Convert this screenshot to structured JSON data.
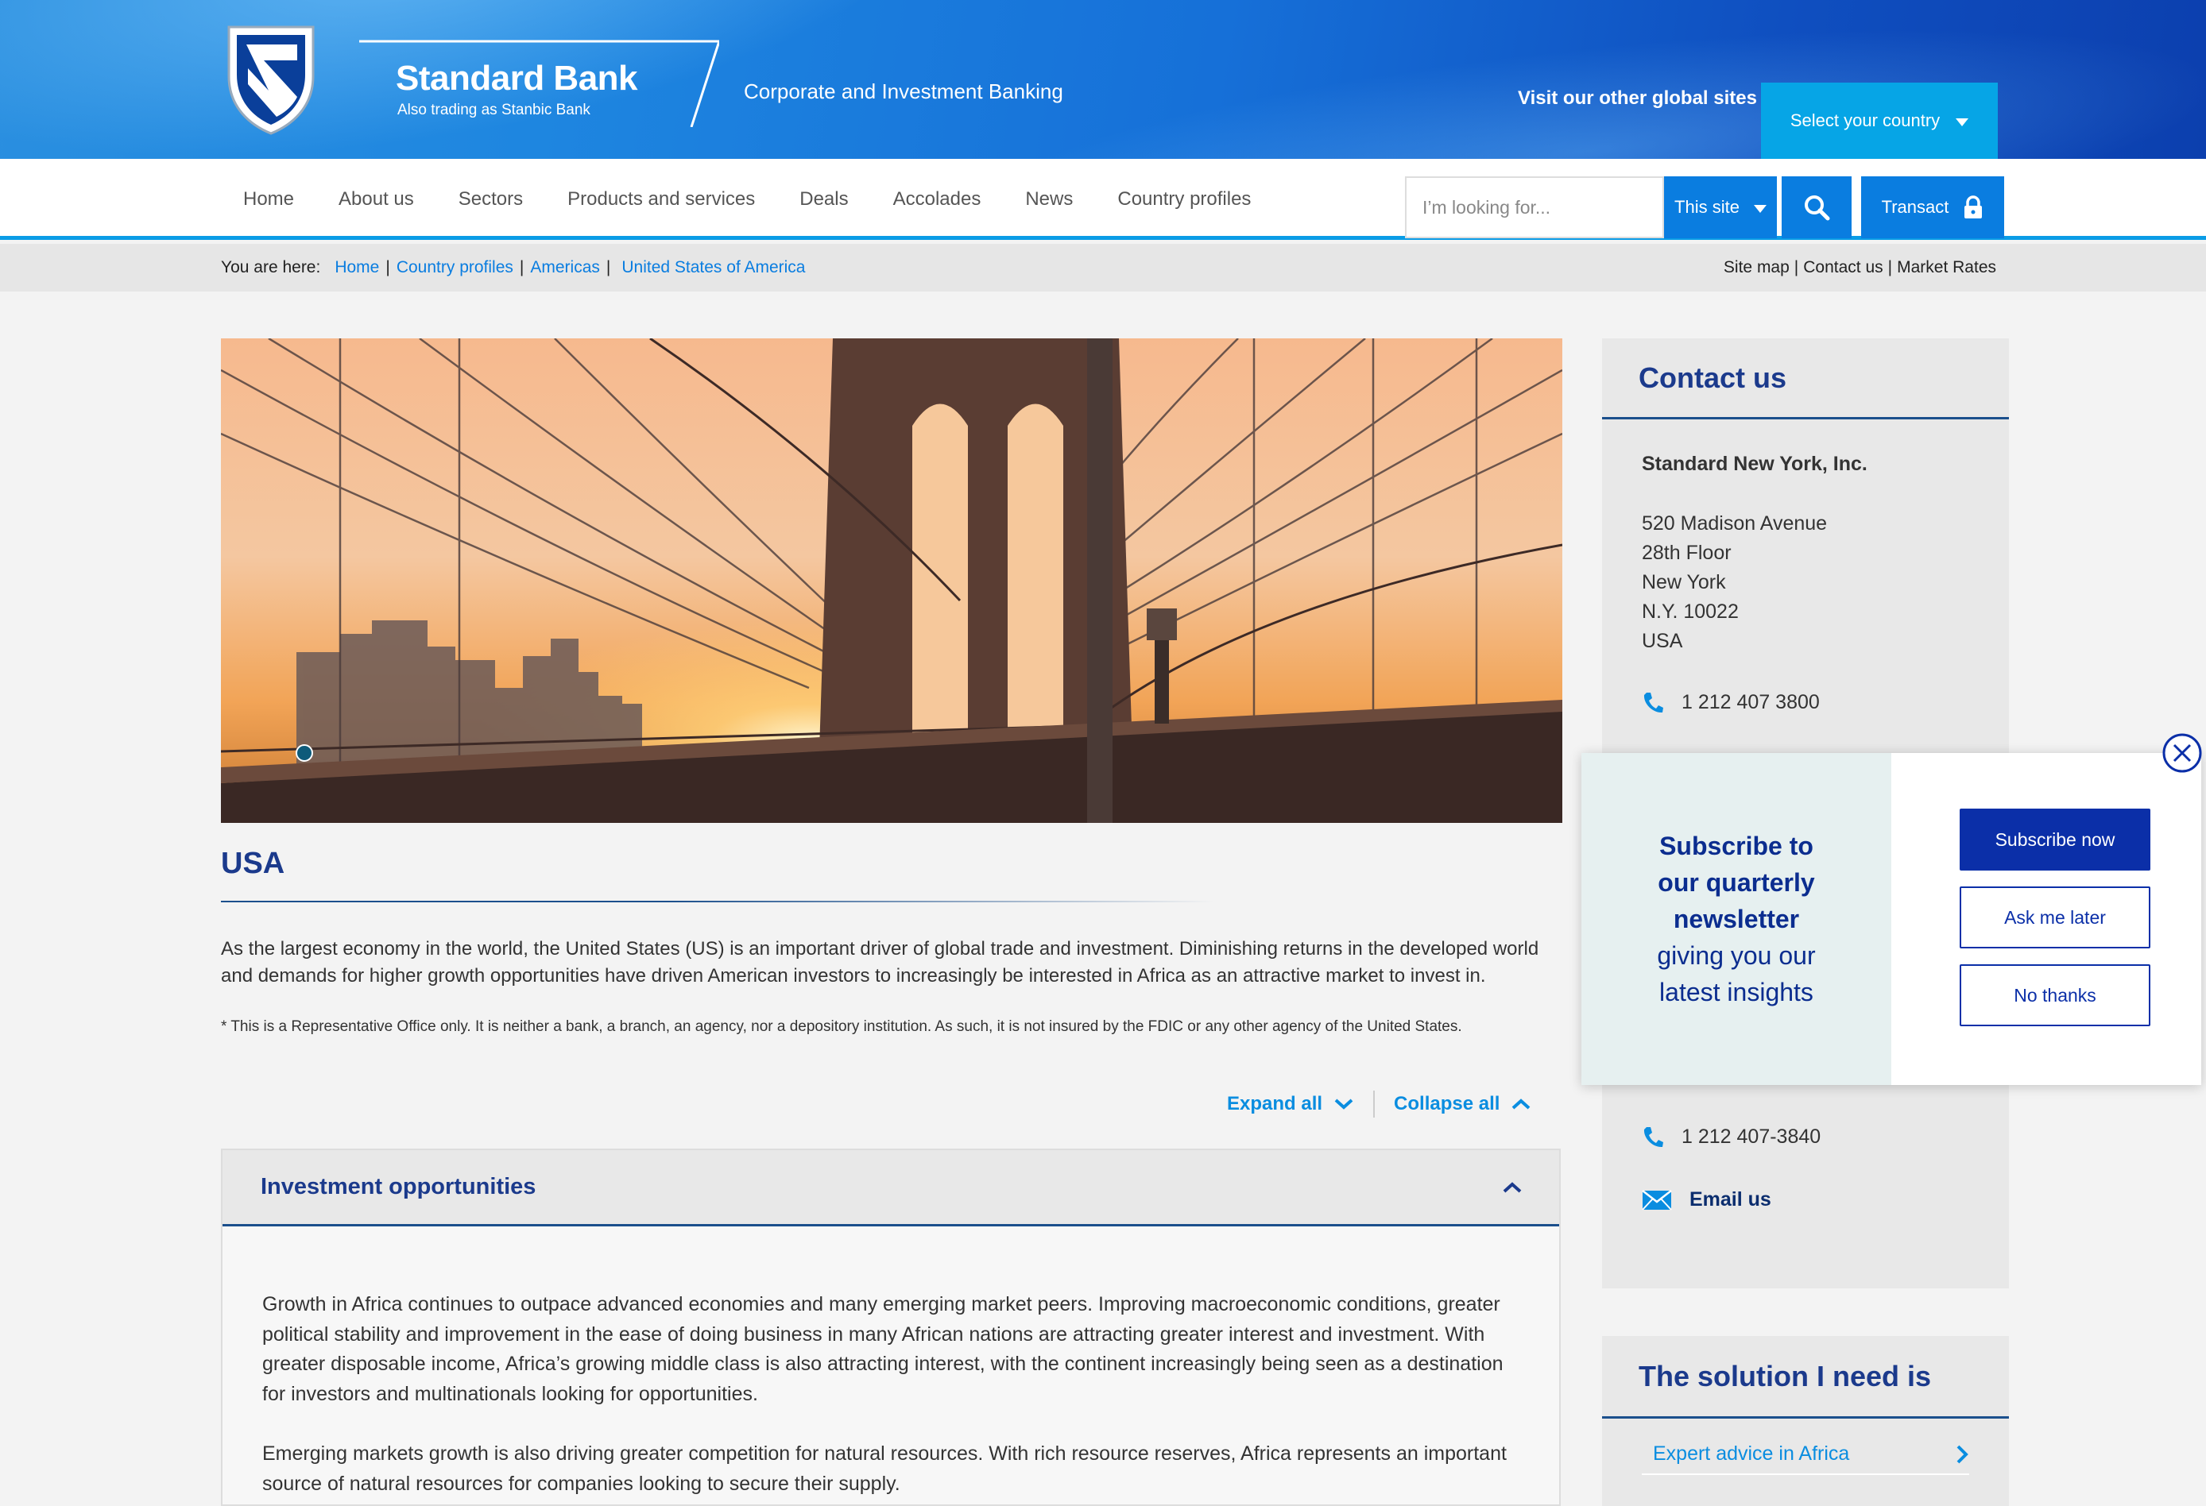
{
  "brand": {
    "name": "Standard Bank",
    "tagline": "Also trading as Stanbic Bank",
    "division": "Corporate and Investment Banking"
  },
  "header": {
    "visit_label": "Visit our other global sites",
    "country_select": "Select your country"
  },
  "nav": {
    "items": [
      "Home",
      "About us",
      "Sectors",
      "Products and services",
      "Deals",
      "Accolades",
      "News",
      "Country profiles"
    ],
    "search_placeholder": "I’m looking for...",
    "scope": "This site",
    "transact": "Transact"
  },
  "breadcrumb": {
    "label": "You are here:",
    "items": [
      "Home",
      "Country profiles",
      "Americas",
      "United States of America"
    ]
  },
  "utility_links": [
    "Site map",
    "Contact us",
    "Market Rates"
  ],
  "page": {
    "title": "USA",
    "intro": "As the largest economy in the world, the United States (US) is an important driver of global trade and investment. Diminishing returns in the developed world and demands for higher growth opportunities have driven American investors to increasingly be interested in Africa as an attractive market to invest in.",
    "note": "* This is a Representative Office only. It is neither a bank, a branch, an agency, nor a depository institution. As such, it is not insured by the FDIC or any other agency of the United States.",
    "expand_all": "Expand all",
    "collapse_all": "Collapse all"
  },
  "accordion": {
    "title": "Investment opportunities",
    "paragraphs": [
      "Growth in Africa continues to outpace advanced economies and many emerging market peers. Improving macroeconomic conditions, greater political stability and improvement in the ease of doing business in many African nations are attracting greater interest and investment. With greater disposable income, Africa’s growing middle class is also attracting interest, with the continent increasingly being seen as a destination for investors and multinationals looking for opportunities.",
      "Emerging markets growth is also driving greater competition for natural resources. With rich resource reserves, Africa represents an important source of natural resources for companies looking to secure their supply."
    ]
  },
  "contact": {
    "heading": "Contact us",
    "org": "Standard New York, Inc.",
    "address": [
      "520 Madison Avenue",
      "28th Floor",
      "New York",
      "N.Y. 10022",
      "USA"
    ],
    "phone": "1 212 407 3800",
    "phone2": "1 212 407-3840",
    "email_label": "Email us"
  },
  "solution": {
    "heading": "The solution I need is",
    "link": "Expert advice in Africa"
  },
  "popup": {
    "line1": "Subscribe to",
    "line2": "our quarterly",
    "line3": "newsletter",
    "line4": "giving you our",
    "line5": "latest insights",
    "subscribe": "Subscribe now",
    "later": "Ask me later",
    "no": "No thanks"
  },
  "colors": {
    "brand_blue": "#1b3a8c",
    "link_blue": "#0a8de0",
    "accent_cyan": "#06a5e6",
    "button_blue": "#0b2fa8"
  }
}
